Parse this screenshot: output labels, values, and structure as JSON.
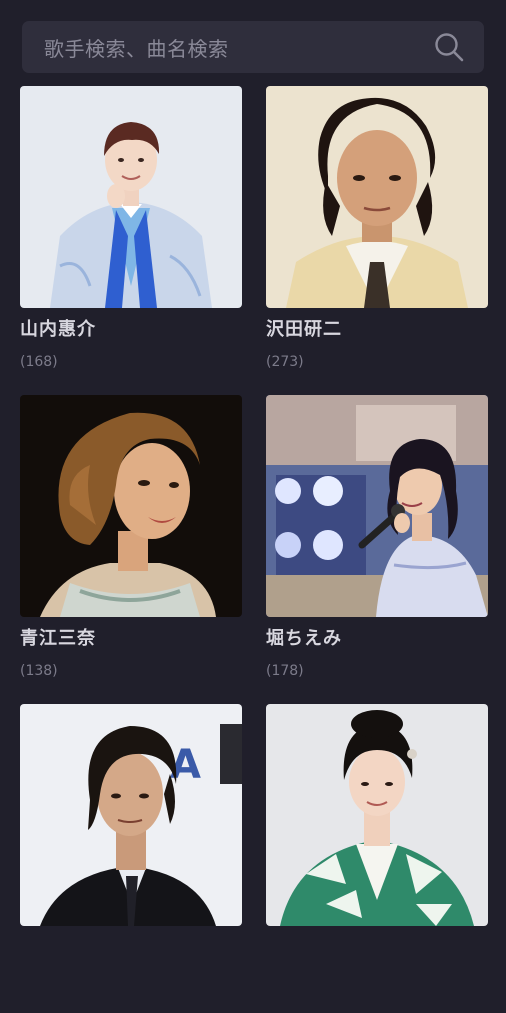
{
  "search": {
    "placeholder": "歌手検索、曲名検索",
    "icon": "search-icon"
  },
  "artists": [
    {
      "name": "山内惠介",
      "count": "(168)"
    },
    {
      "name": "沢田研二",
      "count": "(273)"
    },
    {
      "name": "青江三奈",
      "count": "(138)"
    },
    {
      "name": "堀ちえみ",
      "count": "(178)"
    },
    {
      "name": "",
      "count": ""
    },
    {
      "name": "",
      "count": ""
    }
  ],
  "colors": {
    "background": "#201f2b",
    "search_bg": "#2f2e3c",
    "name_text": "#d8d7df",
    "count_text": "#7c7b8a"
  }
}
